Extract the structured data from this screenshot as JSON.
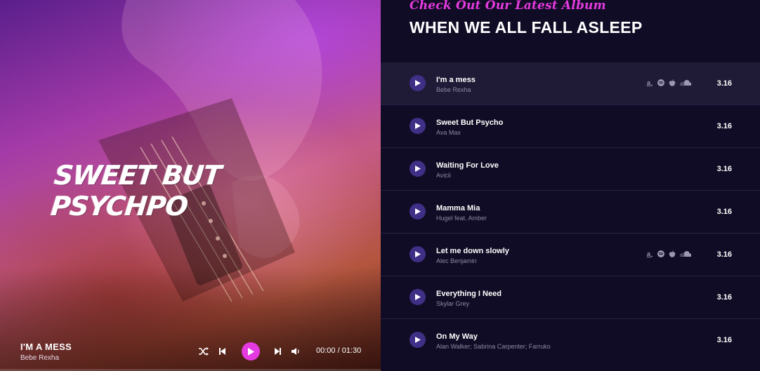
{
  "hero": {
    "title": "SWEET BUT PSYCHPO"
  },
  "now_playing": {
    "title": "I'M A MESS",
    "artist": "Bebe Rexha",
    "time": "00:00 / 01:30",
    "progress": 0
  },
  "controls": {
    "icons": [
      "shuffle-icon",
      "previous-icon",
      "play-icon",
      "next-icon",
      "volume-icon"
    ]
  },
  "album": {
    "tagline": "Check Out Our Latest Album",
    "title": "WHEN WE ALL FALL ASLEEP"
  },
  "tracks": [
    {
      "title": "I'm a mess",
      "artist": "Bebe Rexha",
      "duration": "3.16",
      "has_links": true,
      "active": true
    },
    {
      "title": "Sweet But Psycho",
      "artist": "Ava Max",
      "duration": "3.16",
      "has_links": false,
      "active": false
    },
    {
      "title": "Waiting For Love",
      "artist": "Avicii",
      "duration": "3.16",
      "has_links": false,
      "active": false
    },
    {
      "title": "Mamma Mia",
      "artist": "Hugel feat. Amber",
      "duration": "3.16",
      "has_links": false,
      "active": false
    },
    {
      "title": "Let me down slowly",
      "artist": "Alec Benjamin",
      "duration": "3.16",
      "has_links": true,
      "active": false
    },
    {
      "title": "Everything I Need",
      "artist": "Skylar Grey",
      "duration": "3.16",
      "has_links": false,
      "active": false
    },
    {
      "title": "On My Way",
      "artist": "Alan Walker; Sabrina Carpenter; Farruko",
      "duration": "3.16",
      "has_links": false,
      "active": false
    }
  ],
  "store_icons": [
    "amazon-icon",
    "spotify-icon",
    "apple-icon",
    "soundcloud-icon"
  ],
  "colors": {
    "accent": "#e53ae0",
    "panel_bg": "#110c25",
    "track_play_bg": "#3f2f86"
  }
}
